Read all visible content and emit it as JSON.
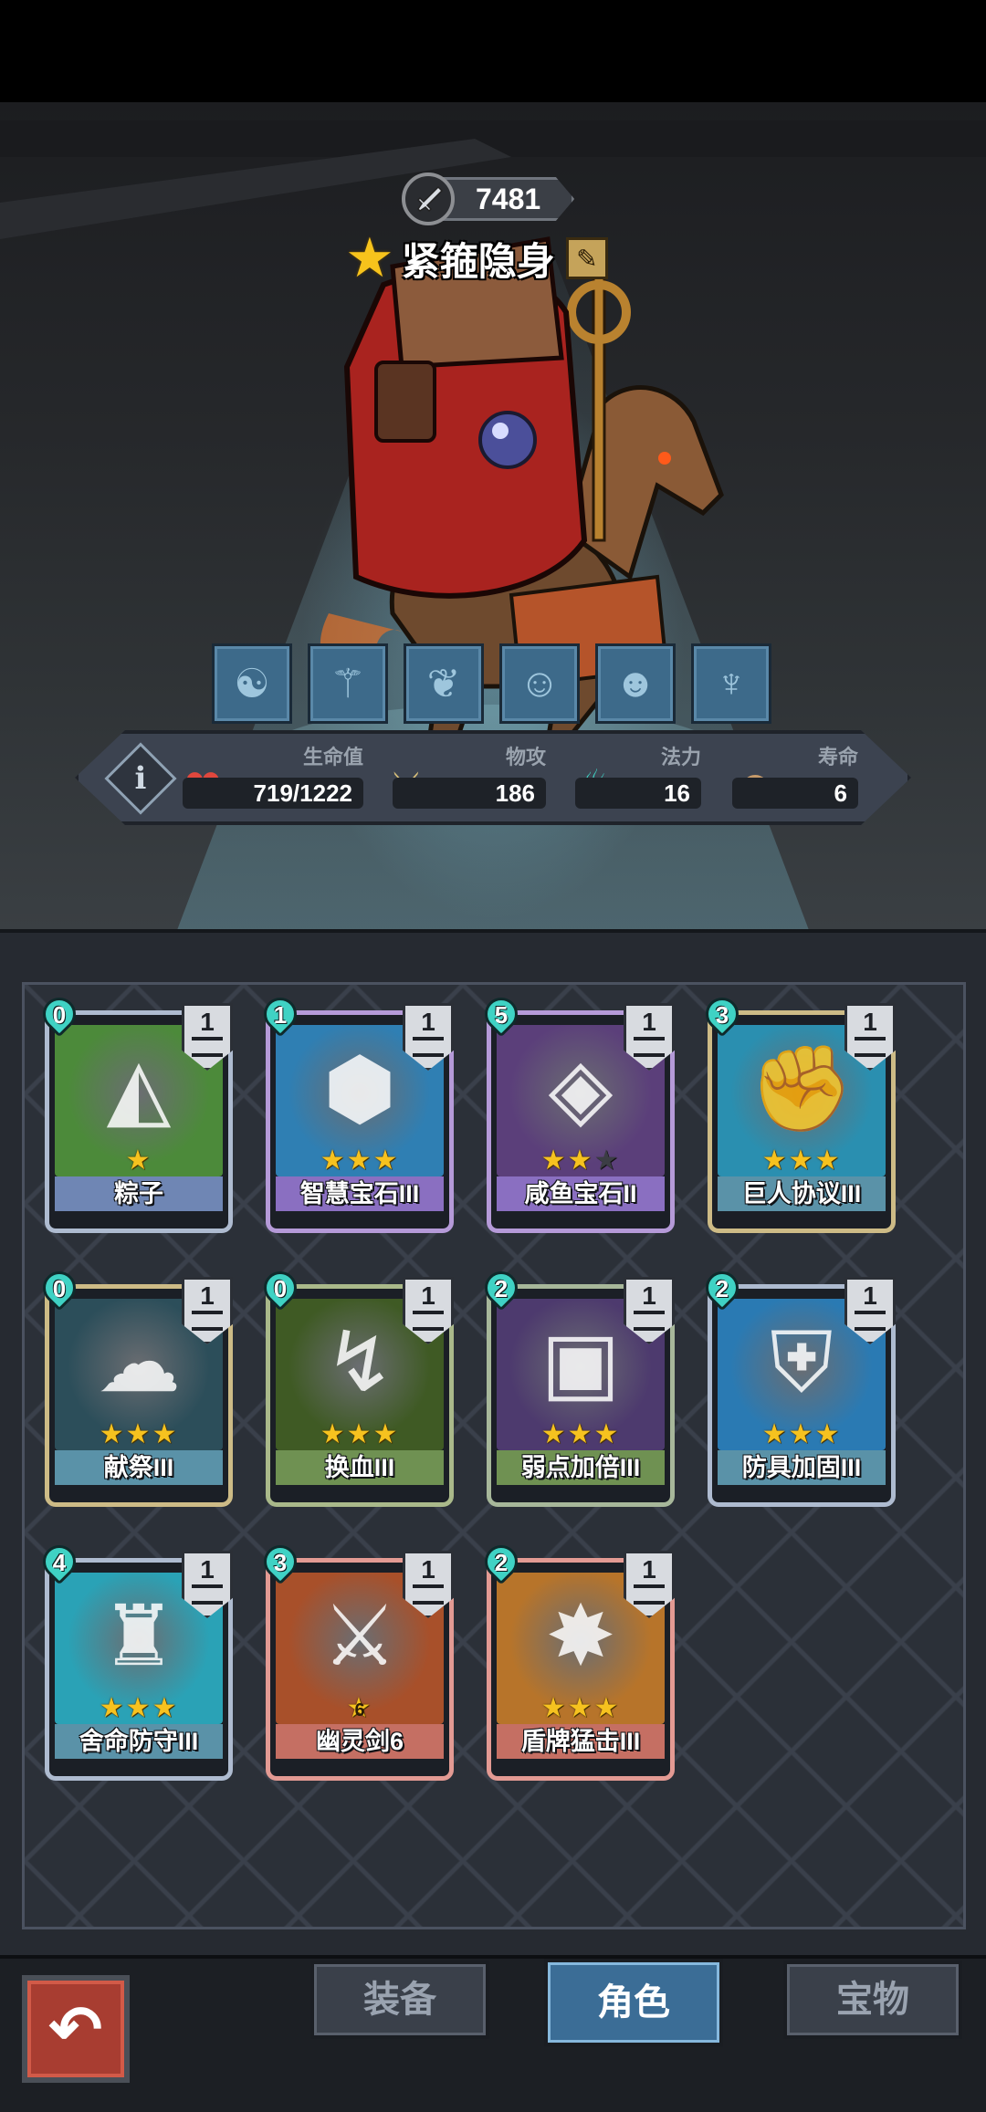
{
  "colors": {
    "accent_blue": "#3b6d96",
    "mana": "#3fd2c4",
    "star_gold": "#f6c21f",
    "back_red": "#a83d31"
  },
  "hero": {
    "power": "7481",
    "name": "紧箍隐身",
    "skill_slots": [
      "meditate-icon",
      "staff-icon",
      "herb-icon",
      "monk-icon",
      "pumpkin-icon",
      "muscle-icon"
    ]
  },
  "stats": {
    "hp": {
      "label": "生命值",
      "value": "719/1222"
    },
    "attack": {
      "label": "物攻",
      "value": "186"
    },
    "mana": {
      "label": "法力",
      "value": "16"
    },
    "lifespan": {
      "label": "寿命",
      "value": "6"
    }
  },
  "cards": [
    {
      "name": "粽子",
      "cost": "0",
      "level": "1",
      "stars": 1,
      "max_stars": 1,
      "art": "#4c8a3a",
      "frame": "#aebbd0",
      "title_bg": "#6f86b4",
      "icon": "zongzi-icon"
    },
    {
      "name": "智慧宝石III",
      "cost": "1",
      "level": "1",
      "stars": 3,
      "max_stars": 3,
      "art": "#2f7fb3",
      "frame": "#b59ad8",
      "title_bg": "#8a6fc1",
      "icon": "gem-icon"
    },
    {
      "name": "咸鱼宝石II",
      "cost": "5",
      "level": "1",
      "stars": 2,
      "max_stars": 3,
      "art": "#5b3f7a",
      "frame": "#b59ad8",
      "title_bg": "#8a6fc1",
      "icon": "fish-icon"
    },
    {
      "name": "巨人协议III",
      "cost": "3",
      "level": "1",
      "stars": 3,
      "max_stars": 3,
      "art": "#2a8fb0",
      "frame": "#cdbb86",
      "title_bg": "#5a92a8",
      "icon": "fist-icon"
    },
    {
      "name": "献祭III",
      "cost": "0",
      "level": "1",
      "stars": 3,
      "max_stars": 3,
      "art": "#2c4e5a",
      "frame": "#cdbb86",
      "title_bg": "#5a92a8",
      "icon": "ghost-icon"
    },
    {
      "name": "换血III",
      "cost": "0",
      "level": "1",
      "stars": 3,
      "max_stars": 3,
      "art": "#3f5a24",
      "frame": "#aab98a",
      "title_bg": "#6f9152",
      "icon": "swap-icon"
    },
    {
      "name": "弱点加倍III",
      "cost": "2",
      "level": "1",
      "stars": 3,
      "max_stars": 3,
      "art": "#4d3a6e",
      "frame": "#a7b79a",
      "title_bg": "#6f9152",
      "icon": "robot-icon"
    },
    {
      "name": "防具加固III",
      "cost": "2",
      "level": "1",
      "stars": 3,
      "max_stars": 3,
      "art": "#2a7ab3",
      "frame": "#aebbd0",
      "title_bg": "#5a92a8",
      "icon": "shield-icon"
    },
    {
      "name": "舍命防守III",
      "cost": "4",
      "level": "1",
      "stars": 3,
      "max_stars": 3,
      "art": "#2aa2b6",
      "frame": "#aebbd0",
      "title_bg": "#5a92a8",
      "icon": "warrior-icon"
    },
    {
      "name": "幽灵剑6",
      "cost": "3",
      "level": "1",
      "stars": 1,
      "max_stars": 1,
      "star_label": "6",
      "art": "#a8502a",
      "frame": "#e39a93",
      "title_bg": "#c56f63",
      "icon": "sword-icon"
    },
    {
      "name": "盾牌猛击III",
      "cost": "2",
      "level": "1",
      "stars": 3,
      "max_stars": 3,
      "art": "#b7742a",
      "frame": "#e39a93",
      "title_bg": "#c56f63",
      "icon": "shield-bash-icon"
    }
  ],
  "nav": {
    "back_icon": "back-arrow-icon",
    "tabs": [
      {
        "label": "装备",
        "active": false
      },
      {
        "label": "角色",
        "active": true
      },
      {
        "label": "宝物",
        "active": false
      }
    ]
  }
}
